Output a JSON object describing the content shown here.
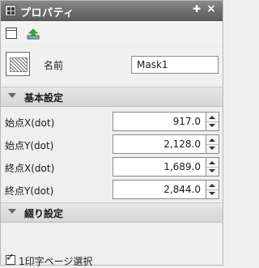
{
  "window": {
    "title": "プロパティ",
    "pin_glyph": "✚",
    "close_glyph": "×"
  },
  "toolbar": {
    "icons": [
      "page-icon",
      "export-icon"
    ]
  },
  "name": {
    "label": "名前",
    "value": "Mask1"
  },
  "sections": {
    "basic": {
      "label": "基本設定"
    },
    "binding": {
      "label": "綴り設定"
    }
  },
  "properties": [
    {
      "label": "始点X(dot)",
      "value": "917.0"
    },
    {
      "label": "始点Y(dot)",
      "value": "2,128.0"
    },
    {
      "label": "終点X(dot)",
      "value": "1,689.0"
    },
    {
      "label": "終点Y(dot)",
      "value": "2,844.0"
    }
  ],
  "checkbox": {
    "label": "1印字ページ選択",
    "checked": true,
    "mark": "✓"
  }
}
